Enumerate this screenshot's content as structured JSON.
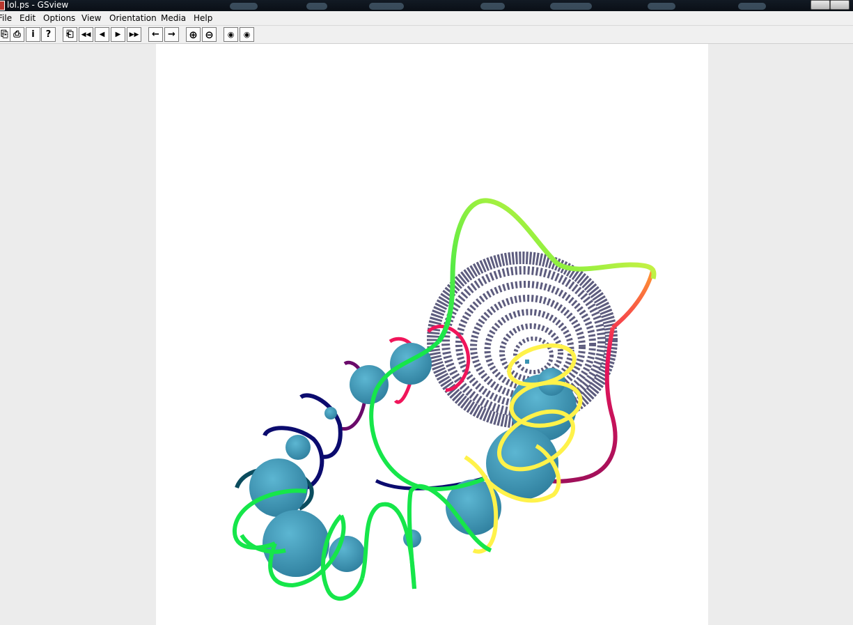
{
  "window": {
    "title": "lol.ps - GSview"
  },
  "menu": {
    "items": [
      "File",
      "Edit",
      "Options",
      "View",
      "Orientation",
      "Media",
      "Help"
    ]
  },
  "toolbar": {
    "buttons": [
      {
        "name": "open-icon",
        "glyph": "⎘"
      },
      {
        "name": "print-icon",
        "glyph": "⎙"
      },
      {
        "name": "info-icon",
        "glyph": "i"
      },
      {
        "name": "help-icon",
        "glyph": "?"
      },
      {
        "name": "goto-page-icon",
        "glyph": "⎗"
      },
      {
        "name": "skip-back-icon",
        "glyph": "◀◀"
      },
      {
        "name": "prev-page-icon",
        "glyph": "◀"
      },
      {
        "name": "next-page-icon",
        "glyph": "▶"
      },
      {
        "name": "skip-forward-icon",
        "glyph": "▶▶"
      },
      {
        "name": "back-arrow-icon",
        "glyph": "←"
      },
      {
        "name": "forward-arrow-icon",
        "glyph": "→"
      },
      {
        "name": "zoom-in-icon",
        "glyph": "⊕"
      },
      {
        "name": "zoom-out-icon",
        "glyph": "⊖"
      },
      {
        "name": "find-text-icon",
        "glyph": "◉"
      },
      {
        "name": "find-next-icon",
        "glyph": "◉"
      }
    ]
  },
  "colors": {
    "torus": "#5d5c7e",
    "sphere": "#3a93b2",
    "ribbon_yellow": "#fff24a",
    "ribbon_green": "#17f24a",
    "ribbon_red": "#f0155a",
    "ribbon_navy": "#0b0b6e",
    "ribbon_purple": "#6a0a6a",
    "ribbon_teal": "#0b4c5e"
  }
}
